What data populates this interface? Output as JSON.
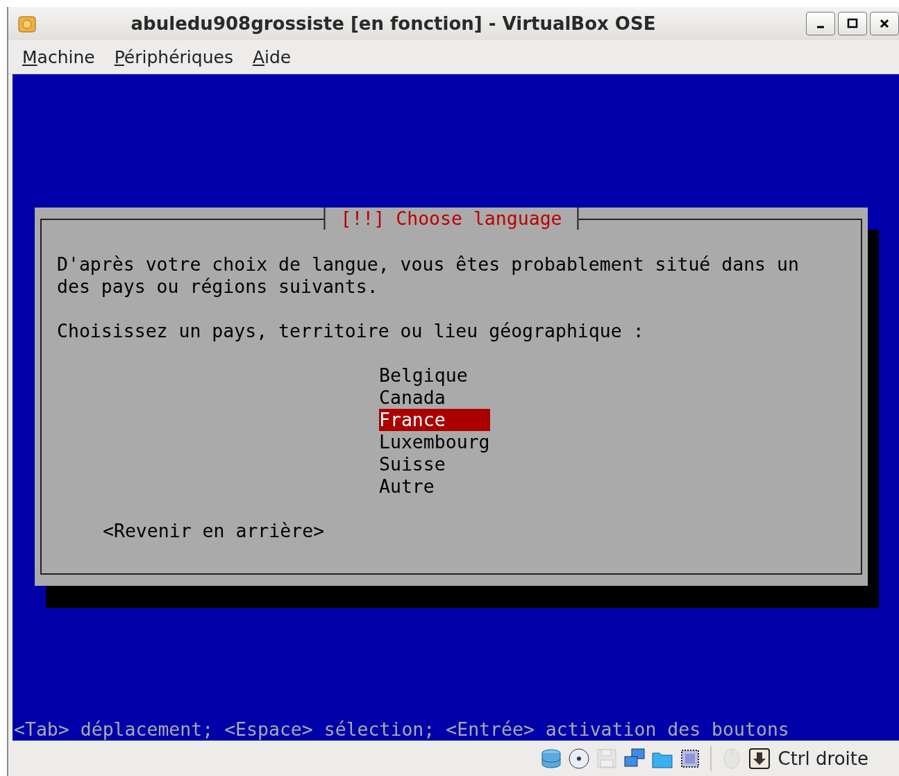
{
  "window": {
    "title": "abuledu908grossiste [en fonction] - VirtualBox OSE"
  },
  "menu": [
    "Machine",
    "Périphériques",
    "Aide"
  ],
  "dialog": {
    "title": "[!!] Choose language",
    "message": "D'après votre choix de langue, vous êtes probablement situé dans un des pays ou régions suivants.",
    "prompt": "Choisissez un pays, territoire ou lieu géographique :",
    "options": [
      {
        "label": "Belgique",
        "selected": false
      },
      {
        "label": "Canada",
        "selected": false
      },
      {
        "label": "France",
        "selected": true
      },
      {
        "label": "Luxembourg",
        "selected": false
      },
      {
        "label": "Suisse",
        "selected": false
      },
      {
        "label": "Autre",
        "selected": false
      }
    ],
    "back_button": "<Revenir en arrière>"
  },
  "help_line": "<Tab> déplacement; <Espace> sélection; <Entrée> activation des boutons",
  "status_bar": {
    "indicators": [
      {
        "kind": "disk",
        "disabled": false
      },
      {
        "kind": "cd",
        "disabled": false
      },
      {
        "kind": "floppy",
        "disabled": true
      },
      {
        "kind": "network",
        "disabled": false
      },
      {
        "kind": "folder",
        "disabled": false
      },
      {
        "kind": "vt",
        "disabled": false
      },
      {
        "kind": "mouse",
        "disabled": true
      },
      {
        "kind": "keyboard",
        "disabled": false
      }
    ],
    "host_key": "Ctrl droite"
  }
}
